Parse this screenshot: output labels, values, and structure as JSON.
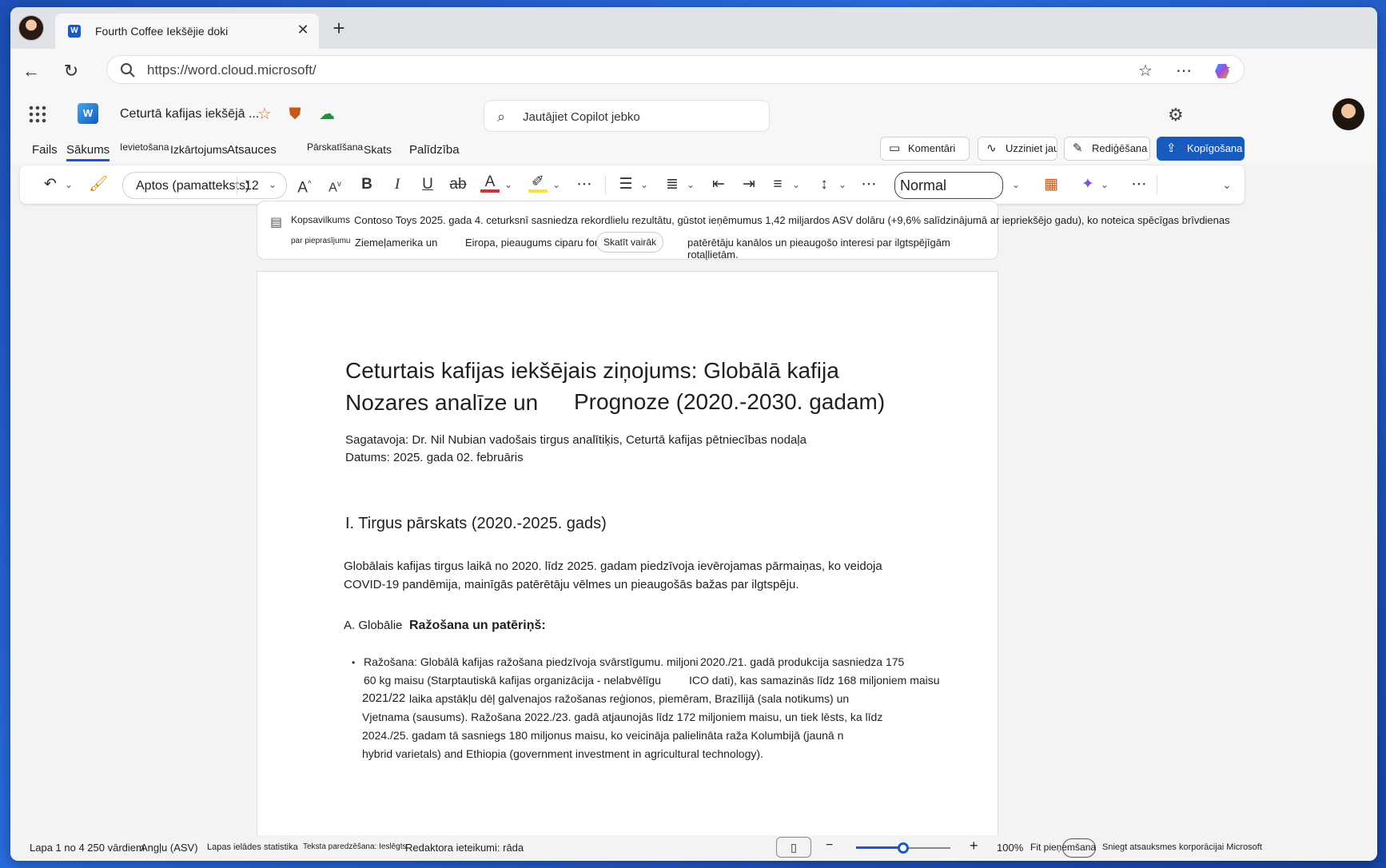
{
  "browser": {
    "tab_title": "Fourth Coffee Iekšējie doki",
    "url": "https://word.cloud.microsoft/"
  },
  "app": {
    "doc_title": "Ceturtā kafijas iekšējā ...",
    "copilot_placeholder": "Jautājiet Copilot jebko",
    "accent_color": "#185abd"
  },
  "ribbon": {
    "tabs": [
      "Fails",
      "Sākums",
      "Ievietošana",
      "Izkārtojums",
      "Atsauces",
      "Pārskatīšana",
      "Skats",
      "Palīdzība"
    ],
    "comments": "Komentāri",
    "catch_up": "Uzziniet jaunumus",
    "editing": "Rediģēšana",
    "share": "Kopīgošana"
  },
  "toolbar": {
    "font_name": "Aptos (pamatteksts)",
    "font_size": "12",
    "style": "Normal"
  },
  "summary": {
    "label1": "Kopsavilkums",
    "label2": "par pieprasījumu",
    "line1": "Contoso Toys 2025. gada 4. ceturksnī sasniedza rekordlielu rezultātu, gūstot ieņēmumus 1,42 miljardos ASV dolāru (+9,6% salīdzinājumā ar iepriekšējo gadu), ko noteica spēcīgas brīvdienas",
    "line2a": "Ziemeļamerika un",
    "line2b": "Eiropa, pieaugums ciparu formā",
    "line2c": "patērētāju kanālos un pieaugošo interesi par ilgtspējīgām rotaļlietām.",
    "see_more": "Skatīt vairāk"
  },
  "document": {
    "title_line1": "Ceturtais kafijas iekšējais ziņojums: Globālā kafija",
    "title_line2a": "Nozares analīze un",
    "title_line2b": "Prognoze (2020.-2030. gadam)",
    "prepared_by": "Sagatavoja: Dr. Nil Nubian vadošais tirgus analītiķis, Ceturtā kafijas pētniecības nodaļa",
    "date": "Datums: 2025. gada 02. februāris",
    "section1": "I. Tirgus pārskats (2020.-2025. gads)",
    "para1_line1": "Globālais kafijas tirgus laikā no 2020. līdz 2025. gadam piedzīvoja ievērojamas pārmaiņas, ko veidoja",
    "para1_line2": "COVID-19 pandēmija, mainīgās patērētāju vēlmes un pieaugošās bažas par ilgtspēju.",
    "sub_a1": "A. Globālie",
    "sub_a2": "Ražošana un patēriņš:",
    "bullet_lines": [
      "Ražošana: Globālā kafijas ražošana piedzīvoja svārstīgumu. miljoni",
      "2020./21. gadā produkcija sasniedza 175",
      "60 kg maisu (Starptautiskā kafijas organizācija - nelabvēlīgu",
      "ICO dati), kas samazinās līdz 168 miljoniem maisu",
      "2021/22",
      "laika apstākļu dēļ galvenajos ražošanas reģionos, piemēram, Brazīlijā (sala notikums) un",
      "Vjetnama (sausums). Ražošana 2022./23. gadā atjaunojās līdz 172 miljoniem maisu, un tiek lēsts, ka līdz",
      "2024./25. gadam tā sasniegs 180 miljonus maisu, ko veicināja palielināta raža Kolumbijā (jaunā n",
      "hybrid varietals) and Ethiopia (government investment in agricultural technology)."
    ]
  },
  "status": {
    "page_count": "Lapa 1 no 4 250 vārdiem",
    "language": "Angļu (ASV)",
    "load_stats": "Lapas ielādes statistika",
    "text_prediction": "Teksta paredzēšana: Ieslēgts",
    "editor": "Redaktora ieteikumi: rāda",
    "zoom": "100%",
    "zoom_level": 0.5,
    "fit": "Fit pieņemšana",
    "feedback": "Sniegt atsauksmes korporācijai Microsoft"
  }
}
